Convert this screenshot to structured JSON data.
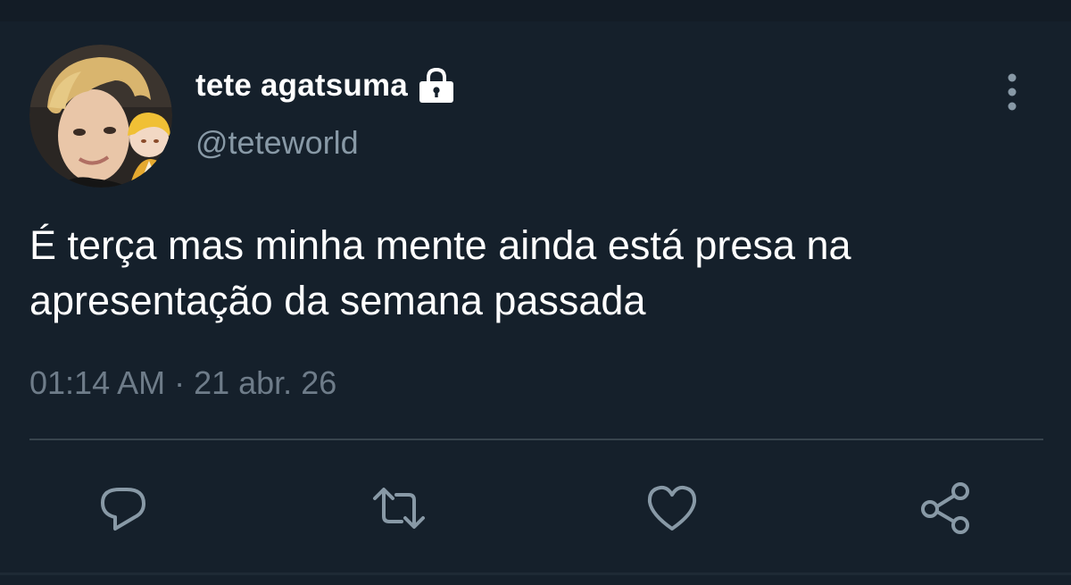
{
  "tweet": {
    "display_name": "tete agatsuma",
    "handle": "@teteworld",
    "text_lines": [
      "É terça mas minha mente ainda está presa na",
      "apresentação da semana passada"
    ],
    "timestamp": "01:14 AM · 21 abr. 26",
    "protected": true
  },
  "icons": {
    "lock": "lock-icon",
    "more": "more-vertical-icon",
    "reply": "reply-icon",
    "retweet": "retweet-icon",
    "like": "heart-icon",
    "share": "share-icon"
  },
  "colors": {
    "background": "#15202b",
    "text": "#ffffff",
    "secondary_text": "#8899a6",
    "icon": "#8899a6",
    "divider": "#38444d"
  }
}
